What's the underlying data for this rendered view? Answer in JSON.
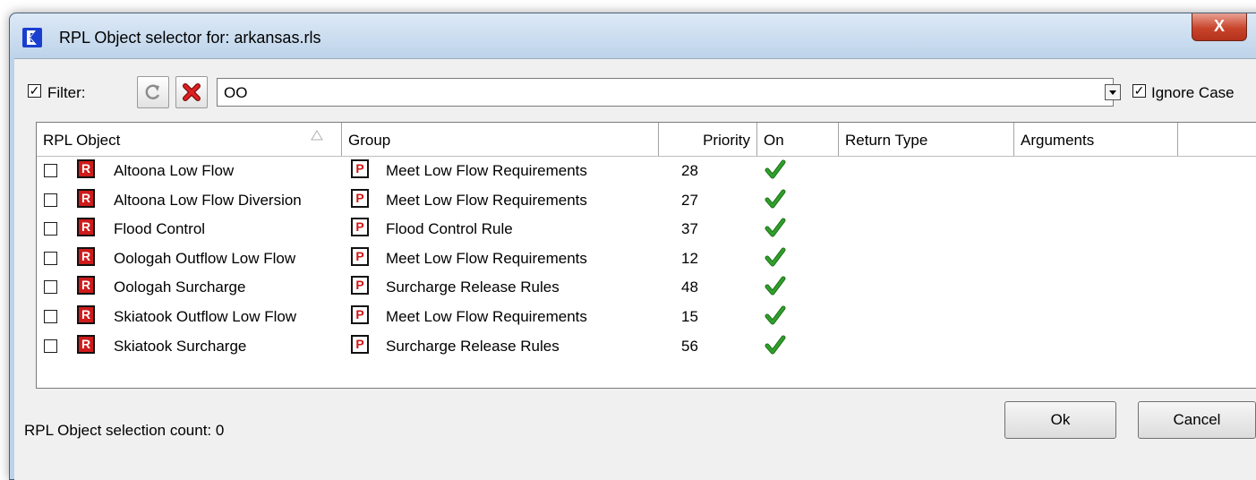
{
  "window": {
    "title": "RPL Object selector for: arkansas.rls",
    "close_label": "X"
  },
  "filter": {
    "enabled": true,
    "label": "Filter:",
    "value": "OO",
    "ignore_case_checked": true,
    "ignore_case_label": "Ignore Case"
  },
  "columns": [
    "RPL Object",
    "Group",
    "Priority",
    "On",
    "Return Type",
    "Arguments"
  ],
  "rows": [
    {
      "selected": false,
      "object": "Altoona Low Flow",
      "group": "Meet Low Flow Requirements",
      "priority": "28",
      "on": true,
      "return_type": "",
      "arguments": ""
    },
    {
      "selected": false,
      "object": "Altoona Low Flow Diversion",
      "group": "Meet Low Flow Requirements",
      "priority": "27",
      "on": true,
      "return_type": "",
      "arguments": ""
    },
    {
      "selected": false,
      "object": "Flood Control",
      "group": "Flood Control Rule",
      "priority": "37",
      "on": true,
      "return_type": "",
      "arguments": ""
    },
    {
      "selected": false,
      "object": "Oologah Outflow Low Flow",
      "group": "Meet Low Flow Requirements",
      "priority": "12",
      "on": true,
      "return_type": "",
      "arguments": ""
    },
    {
      "selected": false,
      "object": "Oologah Surcharge",
      "group": "Surcharge Release Rules",
      "priority": "48",
      "on": true,
      "return_type": "",
      "arguments": ""
    },
    {
      "selected": false,
      "object": "Skiatook Outflow Low Flow",
      "group": "Meet Low Flow Requirements",
      "priority": "15",
      "on": true,
      "return_type": "",
      "arguments": ""
    },
    {
      "selected": false,
      "object": "Skiatook Surcharge",
      "group": "Surcharge Release Rules",
      "priority": "56",
      "on": true,
      "return_type": "",
      "arguments": ""
    }
  ],
  "icons": {
    "rule_icon_letter": "R",
    "policy_group_icon_letter": "P",
    "accent": "#ce1b1b",
    "check_color": "#2fa12a"
  },
  "status": {
    "text": "RPL Object selection count: 0"
  },
  "buttons": {
    "ok": "Ok",
    "cancel": "Cancel"
  }
}
